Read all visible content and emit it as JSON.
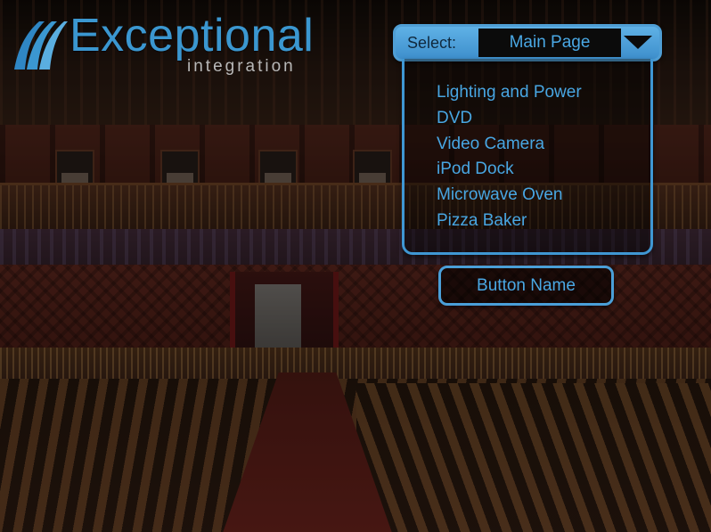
{
  "logo": {
    "word": "Exceptional",
    "subtitle": "integration",
    "mark_icon": "blue-waves-logo-icon",
    "color": "#3b97d0"
  },
  "select": {
    "label": "Select:",
    "current_value": "Main Page",
    "arrow_icon": "triangle-down-icon"
  },
  "menu": {
    "items": [
      {
        "label": "Lighting and Power"
      },
      {
        "label": "DVD"
      },
      {
        "label": "Video Camera"
      },
      {
        "label": "iPod Dock"
      },
      {
        "label": "Microwave Oven"
      },
      {
        "label": "Pizza Baker"
      }
    ]
  },
  "button": {
    "label": "Button Name"
  },
  "background": {
    "scene": "theatre-auditorium-photo"
  },
  "colors": {
    "accent": "#4aa8e4",
    "bar": "#4f9ed4",
    "bar_text": "#10293d"
  }
}
